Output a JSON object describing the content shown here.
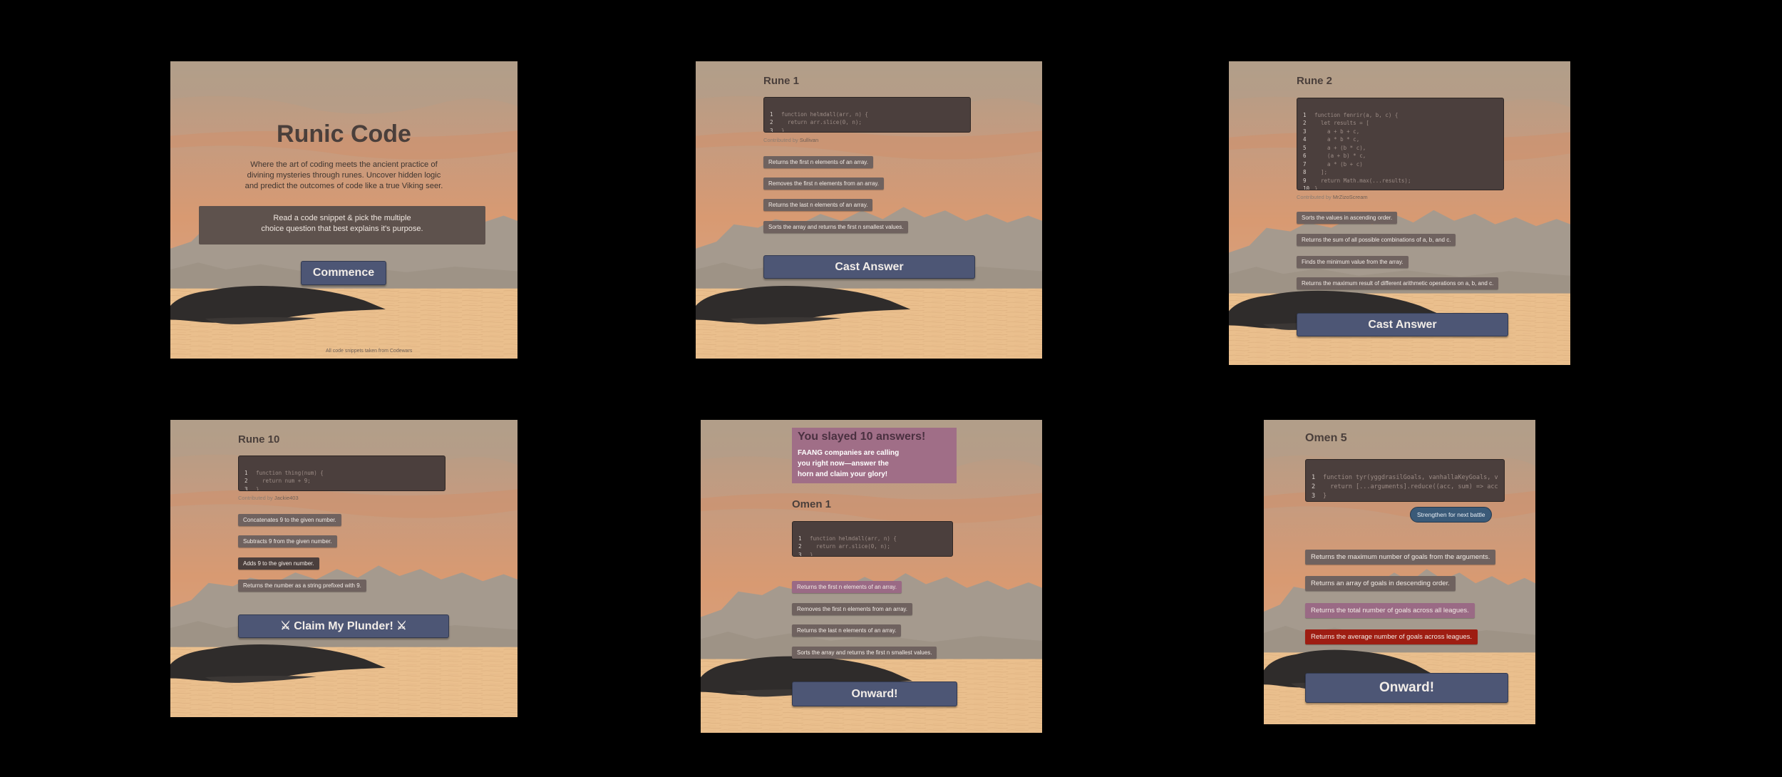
{
  "colors": {
    "sky_top": "#b59e87",
    "sky_orange": "#d89a72",
    "mountains": "#a49a8e",
    "sand": "#eabf8d",
    "rock": "#2e2c2b",
    "button": "#4d5675",
    "option": "#6f625f",
    "option_selected": "#9a6a85",
    "option_wrong": "#9e1d12"
  },
  "screen1": {
    "title": "Runic Code",
    "desc_lines": [
      "Where the art of coding meets the ancient practice of",
      "divining mysteries through runes. Uncover hidden logic",
      "and predict the outcomes of code like a true Viking seer."
    ],
    "instr_lines": [
      "Read a code snippet & pick the multiple",
      "choice question that best explains it's purpose."
    ],
    "button": "Commence",
    "footnote": "All code snippets taken from Codewars"
  },
  "screen2": {
    "title": "Rune 1",
    "code": [
      {
        "n": "1",
        "t": "function helmdall(arr, n) {"
      },
      {
        "n": "2",
        "t": "  return arr.slice(0, n);"
      },
      {
        "n": "3",
        "t": "}"
      }
    ],
    "attr_prefix": "Contributed by",
    "attr_name": "Sullivan",
    "options": [
      "Returns the first n elements of an array.",
      "Removes the first n elements from an array.",
      "Returns the last n elements of an array.",
      "Sorts the array and returns the first n smallest values."
    ],
    "button": "Cast Answer"
  },
  "screen3": {
    "title": "Rune 2",
    "code": [
      {
        "n": "1",
        "t": "function fenrir(a, b, c) {"
      },
      {
        "n": "2",
        "t": "  let results = ["
      },
      {
        "n": "3",
        "t": "    a + b + c,"
      },
      {
        "n": "4",
        "t": "    a * b * c,"
      },
      {
        "n": "5",
        "t": "    a + (b * c),"
      },
      {
        "n": "6",
        "t": "    (a + b) * c,"
      },
      {
        "n": "7",
        "t": "    a * (b + c)"
      },
      {
        "n": "8",
        "t": "  ];"
      },
      {
        "n": "9",
        "t": "  return Math.max(...results);"
      },
      {
        "n": "10",
        "t": "}"
      }
    ],
    "attr_prefix": "Contributed by",
    "attr_name": "MrZizoScream",
    "options": [
      "Sorts the values in ascending order.",
      "Returns the sum of all possible combinations of a, b, and c.",
      "Finds the minimum value from the array.",
      "Returns the maximum result of different arithmetic operations on a, b, and c."
    ],
    "button": "Cast Answer"
  },
  "screen4": {
    "title": "Rune 10",
    "code": [
      {
        "n": "1",
        "t": "function thing(num) {"
      },
      {
        "n": "2",
        "t": "  return num + 9;"
      },
      {
        "n": "3",
        "t": "}"
      }
    ],
    "attr_prefix": "Contributed by",
    "attr_name": "Jackie403",
    "options": [
      "Concatenates 9 to the given number.",
      "Subtracts 9 from the given number.",
      "Adds 9 to the given number.",
      "Returns the number as a string prefixed with 9."
    ],
    "button": "Claim My Plunder!"
  },
  "screen5": {
    "win_title": "You slayed 10 answers!",
    "win_lines": [
      "FAANG companies are calling",
      "you right now—answer the",
      "horn and claim your glory!"
    ],
    "title": "Omen 1",
    "code": [
      {
        "n": "1",
        "t": "function helmdall(arr, n) {"
      },
      {
        "n": "2",
        "t": "  return arr.slice(0, n);"
      },
      {
        "n": "3",
        "t": "}"
      }
    ],
    "options": [
      "Returns the first n elements of an array.",
      "Removes the first n elements from an array.",
      "Returns the last n elements of an array.",
      "Sorts the array and returns the first n smallest values."
    ],
    "button": "Onward!"
  },
  "screen6": {
    "title": "Omen 5",
    "code": [
      {
        "n": "1",
        "t": "function tyr(yggdrasilGoals, vanhallaKeyGoals, v"
      },
      {
        "n": "2",
        "t": "  return [...arguments].reduce((acc, sum) => acc"
      },
      {
        "n": "3",
        "t": "}"
      }
    ],
    "pill": "Strengthen for next battle",
    "options": [
      "Returns the maximum number of goals from the arguments.",
      "Returns an array of goals in descending order.",
      "Returns the total number of goals across all leagues.",
      "Returns the average number of goals across leagues."
    ],
    "button": "Onward!"
  }
}
